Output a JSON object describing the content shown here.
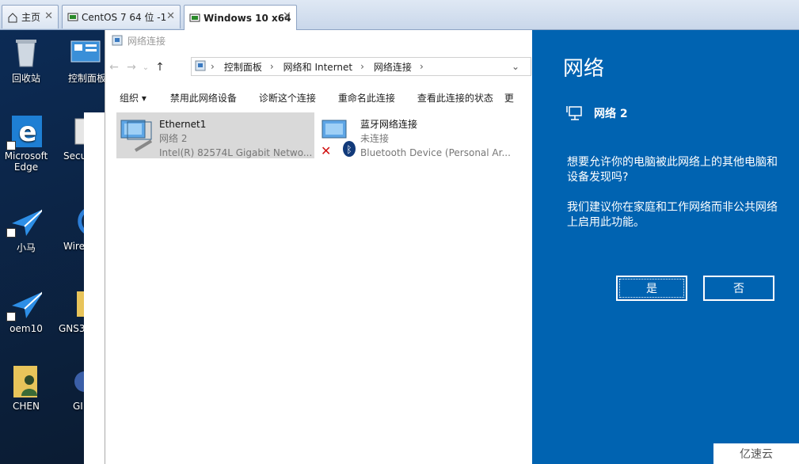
{
  "tabs": [
    {
      "label": "主页",
      "icon": "home-icon",
      "active": false
    },
    {
      "label": "CentOS 7 64 位 -1",
      "icon": "vm-icon",
      "active": false
    },
    {
      "label": "Windows 10 x64",
      "icon": "vm-icon",
      "active": true
    }
  ],
  "desktop_icons": [
    {
      "label": "回收站",
      "icon": "recycle-bin-icon"
    },
    {
      "label": "控制面板",
      "icon": "control-panel-icon"
    },
    {
      "label": "Microsoft Edge",
      "icon": "edge-icon"
    },
    {
      "label": "Secu",
      "icon": "app-icon"
    },
    {
      "label": "小马",
      "icon": "plane-icon"
    },
    {
      "label": "Wire",
      "icon": "wireshark-icon"
    },
    {
      "label": "oem10",
      "icon": "plane-icon"
    },
    {
      "label": "GNS3",
      "icon": "folder-icon"
    },
    {
      "label": "CHEN",
      "icon": "user-folder-icon"
    },
    {
      "label": "GI",
      "icon": "app-icon"
    }
  ],
  "explorer": {
    "title": "网络连接",
    "breadcrumb": [
      "控制面板",
      "网络和 Internet",
      "网络连接"
    ],
    "toolbar": [
      "组织 ▾",
      "禁用此网络设备",
      "诊断这个连接",
      "重命名此连接",
      "查看此连接的状态",
      "更"
    ],
    "items": [
      {
        "name": "Ethernet1",
        "status": "网络  2",
        "device": "Intel(R) 82574L Gigabit Netwo...",
        "selected": true
      },
      {
        "name": "蓝牙网络连接",
        "status": "未连接",
        "device": "Bluetooth Device (Personal Ar...",
        "selected": false
      }
    ]
  },
  "flyout": {
    "title": "网络",
    "network_name": "网络  2",
    "prompt": "想要允许你的电脑被此网络上的其他电脑和设备发现吗?",
    "advice": "我们建议你在家庭和工作网络而非公共网络上启用此功能。",
    "yes_label": "是",
    "no_label": "否",
    "accent_color": "#0063b1"
  },
  "watermark": "亿速云"
}
